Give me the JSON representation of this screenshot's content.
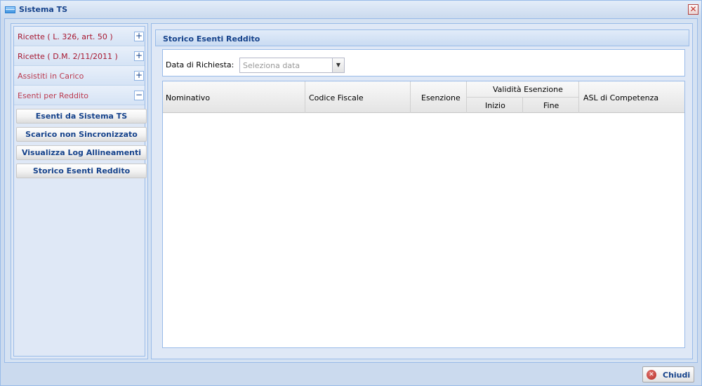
{
  "window": {
    "title": "Sistema TS",
    "close_glyph": "✕"
  },
  "sidebar": {
    "sections": [
      {
        "label": "Ricette ( L. 326, art. 50 )",
        "toggle": "+"
      },
      {
        "label": "Ricette ( D.M. 2/11/2011 )",
        "toggle": "+"
      },
      {
        "label": "Assistiti in Carico",
        "toggle": "+"
      },
      {
        "label": "Esenti per Reddito",
        "toggle": "−"
      }
    ],
    "buttons": [
      {
        "label": "Esenti da Sistema TS"
      },
      {
        "label": "Scarico non Sincronizzato"
      },
      {
        "label": "Visualizza Log Allineamenti"
      },
      {
        "label": "Storico Esenti Reddito"
      }
    ]
  },
  "main": {
    "title": "Storico Esenti Reddito",
    "filter": {
      "label": "Data di Richiesta:",
      "placeholder": "Seleziona data",
      "value": ""
    },
    "grid": {
      "columns": {
        "nominativo": "Nominativo",
        "codice_fiscale": "Codice Fiscale",
        "esenzione": "Esenzione",
        "validita": "Validità Esenzione",
        "inizio": "Inizio",
        "fine": "Fine",
        "asl": "ASL di Competenza"
      },
      "rows": []
    }
  },
  "footer": {
    "close_label": "Chiudi"
  },
  "colors": {
    "accent": "#15428b",
    "section_label": "#a8162e",
    "border": "#99bbe8"
  }
}
